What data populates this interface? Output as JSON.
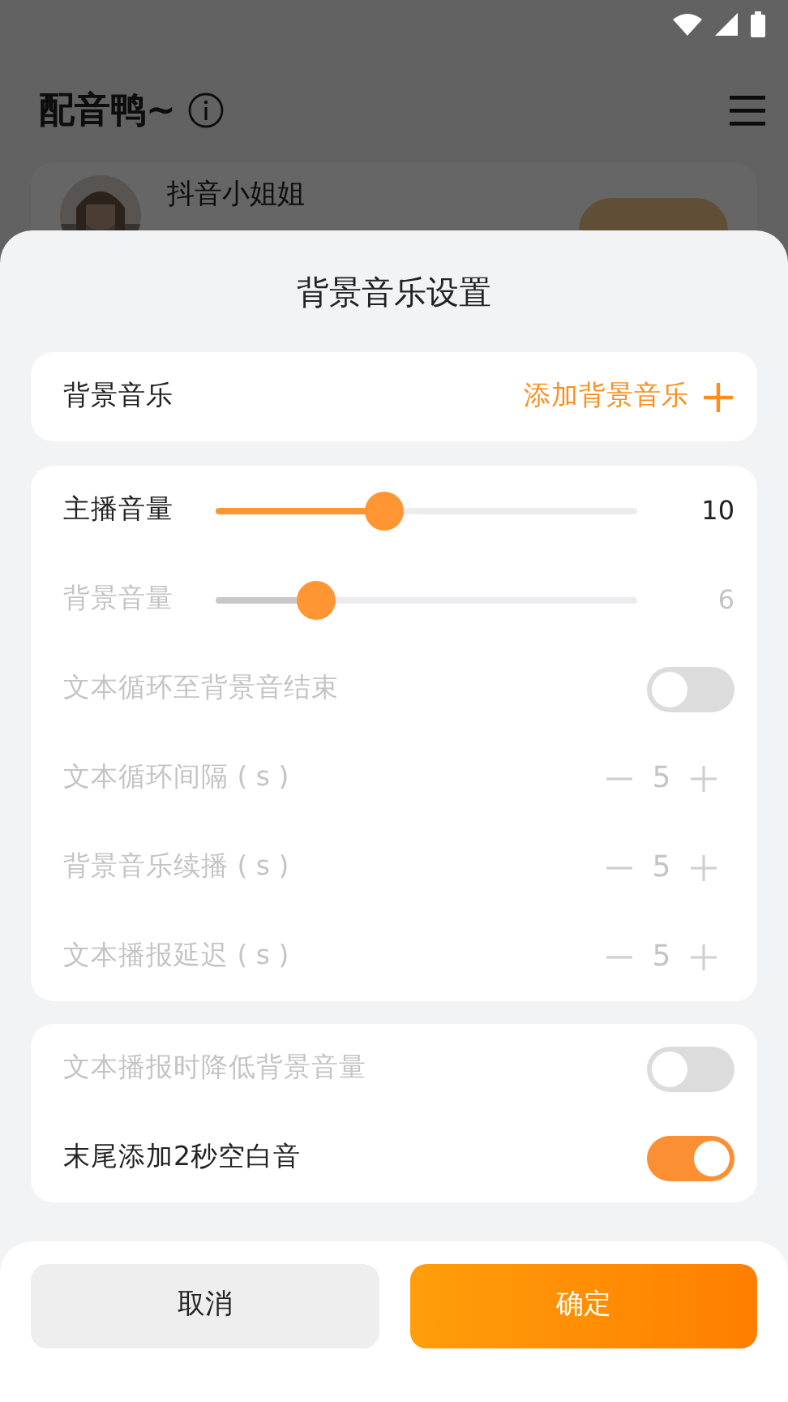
{
  "app": {
    "title": "配音鸭~",
    "card": {
      "name": "抖音小姐姐"
    }
  },
  "sheet": {
    "title": "背景音乐设置",
    "music": {
      "label": "背景音乐",
      "action": "添加背景音乐"
    },
    "settings": [
      {
        "kind": "slider",
        "label": "主播音量",
        "level": 0.4,
        "reading": "10",
        "disabled": false
      },
      {
        "kind": "slider",
        "label": "背景音量",
        "level": 0.24,
        "reading": "6",
        "disabled": true
      },
      {
        "kind": "toggle",
        "label": "文本循环至背景音结束",
        "on": false,
        "disabled": true
      },
      {
        "kind": "stepper",
        "label": "文本循环间隔 ( s )",
        "value": "5",
        "disabled": true
      },
      {
        "kind": "stepper",
        "label": "背景音乐续播 ( s )",
        "value": "5",
        "disabled": true
      },
      {
        "kind": "stepper",
        "label": "文本播报延迟 ( s )",
        "value": "5",
        "disabled": true
      }
    ],
    "options": [
      {
        "kind": "toggle",
        "label": "文本播报时降低背景音量",
        "on": false,
        "disabled": true
      },
      {
        "kind": "toggle",
        "label": "末尾添加2秒空白音",
        "on": true,
        "disabled": false
      }
    ],
    "buttons": [
      {
        "kind": "secondary",
        "label": "取消"
      },
      {
        "kind": "primary",
        "label": "确定"
      }
    ]
  }
}
